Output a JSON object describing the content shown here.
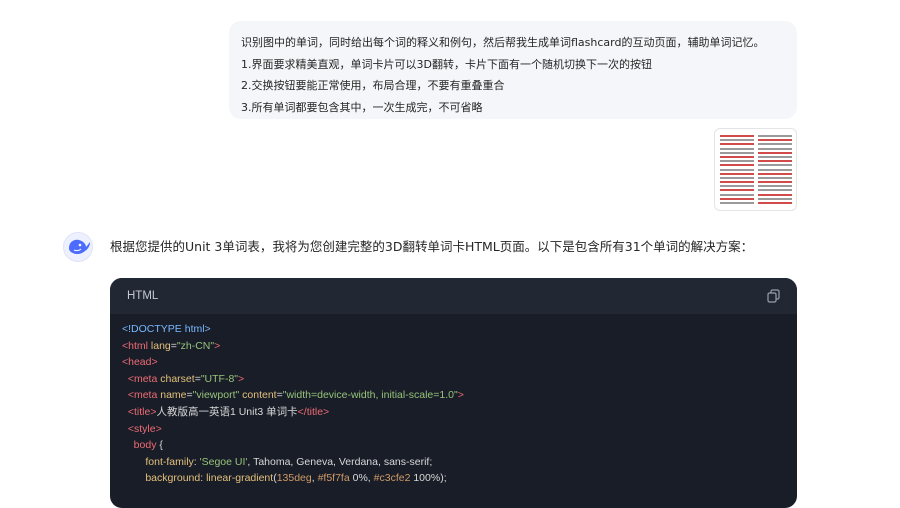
{
  "user_message": {
    "lines": [
      "识别图中的单词，同时给出每个词的释义和例句，然后帮我生成单词flashcard的互动页面，辅助单词记忆。",
      "1.界面要求精美直观，单词卡片可以3D翻转，卡片下面有一个随机切换下一次的按钮",
      "2.交换按钮要能正常使用，布局合理，不要有重叠重合",
      "3.所有单词都要包含其中，一次生成完，不可省略"
    ],
    "attachment_icon": "image-thumbnail-icon"
  },
  "assistant": {
    "avatar_icon": "whale-logo-icon",
    "intro": "根据您提供的Unit 3单词表，我将为您创建完整的3D翻转单词卡HTML页面。以下是包含所有31个单词的解决方案：",
    "code_block": {
      "language": "HTML",
      "copy_icon": "copy-icon",
      "lines": {
        "l1": "<!DOCTYPE html>",
        "l2_open": "<html ",
        "l2_attr": "lang",
        "l2_eq": "=",
        "l2_val": "\"zh-CN\"",
        "l2_close": ">",
        "l3": "<head>",
        "l4_open": "<meta ",
        "l4_attr": "charset",
        "l4_eq": "=",
        "l4_val": "\"UTF-8\"",
        "l4_close": ">",
        "l5_open": "<meta ",
        "l5_attr1": "name",
        "l5_eq1": "=",
        "l5_val1": "\"viewport\"",
        "l5_attr2": " content",
        "l5_eq2": "=",
        "l5_val2": "\"width=device-width, initial-scale=1.0\"",
        "l5_close": ">",
        "l6_open": "<title>",
        "l6_text": "人教版高一英语1 Unit3 单词卡",
        "l6_close": "</title>",
        "l7": "<style>",
        "l8_sel": "body",
        "l8_brace": " {",
        "l9_prop": "font-family",
        "l9_colon": ": ",
        "l9_val1": "'Segoe UI'",
        "l9_rest": ", Tahoma, Geneva, Verdana, sans-serif;",
        "l10_prop": "background",
        "l10_colon": ": ",
        "l10_fn": "linear-gradient",
        "l10_open": "(",
        "l10_deg": "135deg",
        "l10_c1": ", ",
        "l10_hex1": "#f5f7fa",
        "l10_p1": " 0%, ",
        "l10_hex2": "#c3cfe2",
        "l10_p2": " 100%",
        "l10_end": ");"
      }
    }
  },
  "colors": {
    "code_bg": "#181d28",
    "code_header_bg": "#222734",
    "tag": "#ef6b73",
    "doctype": "#79b8ff",
    "attr": "#e5c07b",
    "string": "#98c379",
    "user_bubble_bg": "#f4f6fa"
  }
}
